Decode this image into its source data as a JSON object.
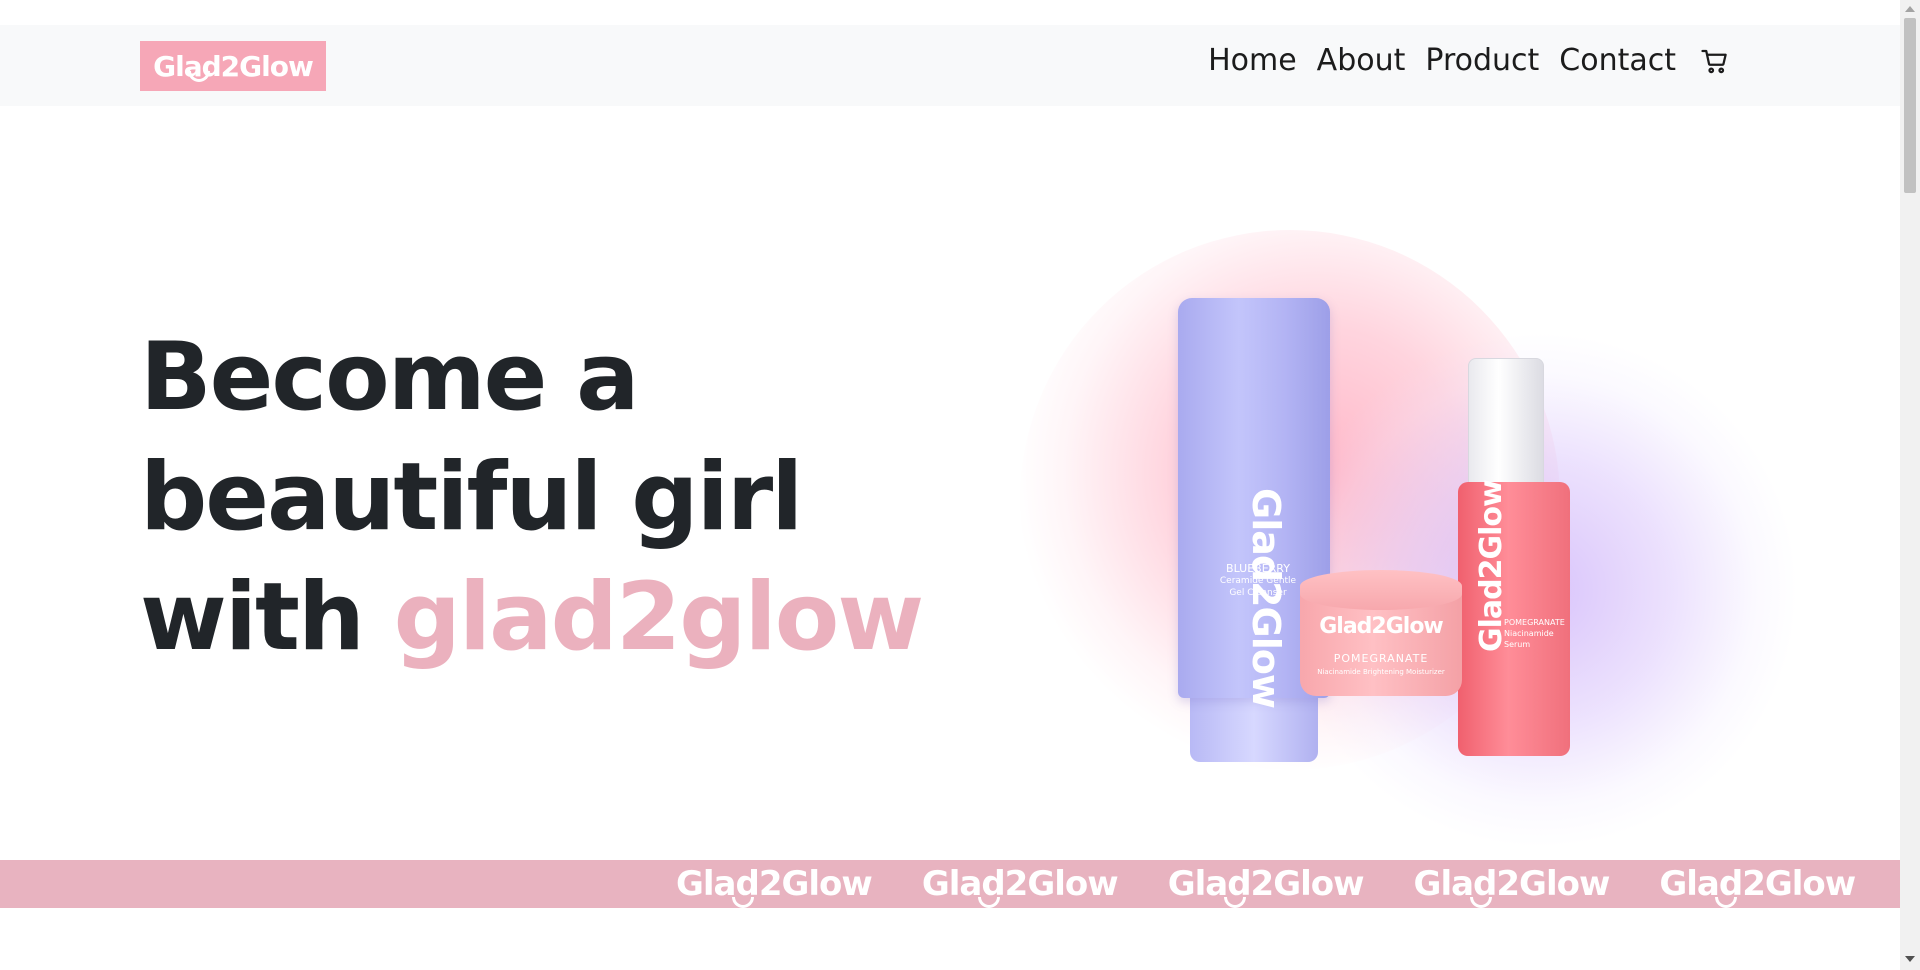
{
  "brand": {
    "logo_text": "Glad2Glow",
    "color": "#f6a7b7"
  },
  "nav": {
    "items": [
      {
        "label": "Home"
      },
      {
        "label": "About"
      },
      {
        "label": "Product"
      },
      {
        "label": "Contact"
      }
    ],
    "cart_icon": "cart-icon"
  },
  "hero": {
    "title_line1": "Become a",
    "title_line2": "beautiful girl",
    "title_line3_prefix": "with ",
    "title_accent": "glad2glow",
    "accent_color": "#ebb1be"
  },
  "products": {
    "tube": {
      "logo": "Glad2Glow",
      "name": "BLUEBERRY",
      "desc": "Ceramide Gentle Gel Cleanser"
    },
    "jar": {
      "logo": "Glad2Glow",
      "name": "POMEGRANATE",
      "desc": "Niacinamide Brightening Moisturizer"
    },
    "bottle": {
      "logo": "Glad2Glow",
      "name": "POMEGRANATE",
      "desc": "Niacinamide Serum"
    }
  },
  "marquee": {
    "items": [
      "Glad2Glow",
      "Glad2Glow",
      "Glad2Glow",
      "Glad2Glow",
      "Glad2Glow"
    ],
    "color": "#e8b3c0"
  }
}
